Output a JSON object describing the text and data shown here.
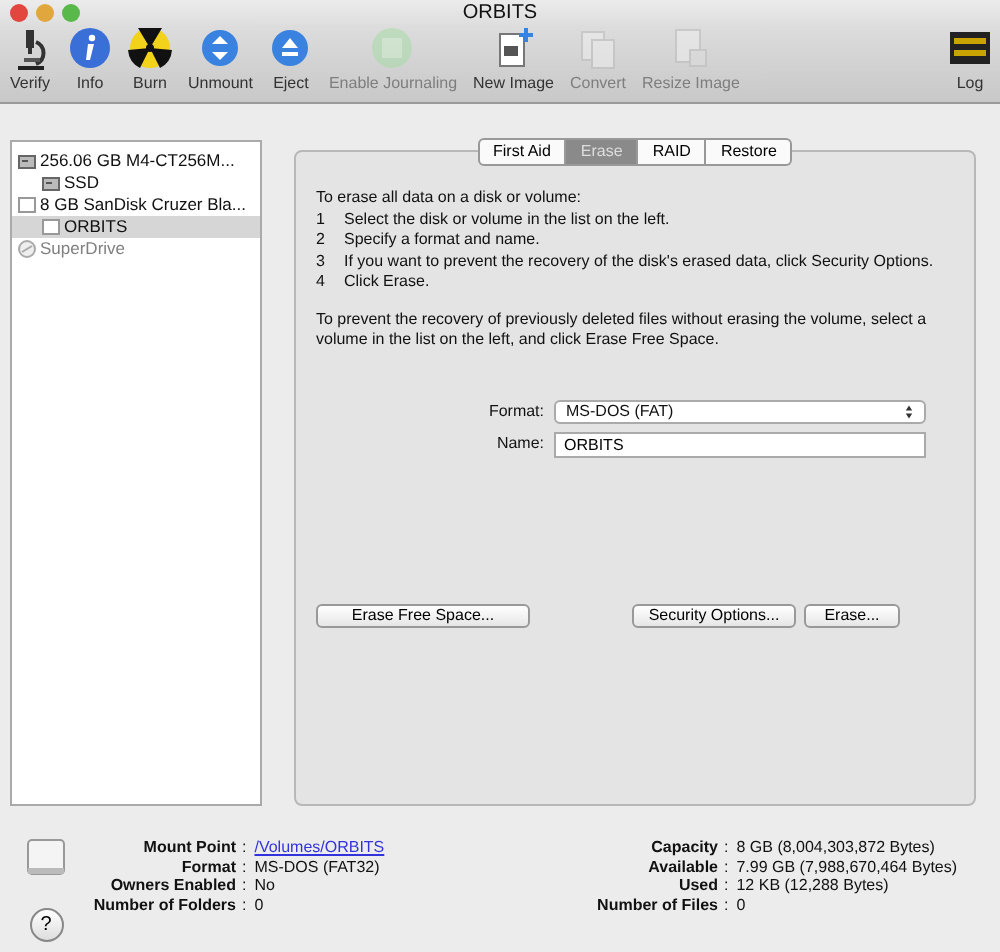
{
  "window": {
    "title": "ORBITS"
  },
  "toolbar": [
    {
      "label": "Verify",
      "kind": "microscope",
      "disabled": false
    },
    {
      "label": "Info",
      "kind": "info",
      "disabled": false
    },
    {
      "label": "Burn",
      "kind": "burn",
      "disabled": false
    },
    {
      "label": "Unmount",
      "kind": "unmount",
      "disabled": false
    },
    {
      "label": "Eject",
      "kind": "eject",
      "disabled": false
    },
    {
      "label": "Enable Journaling",
      "kind": "journal",
      "disabled": true
    },
    {
      "label": "New Image",
      "kind": "new-image",
      "disabled": false
    },
    {
      "label": "Convert",
      "kind": "convert",
      "disabled": true
    },
    {
      "label": "Resize Image",
      "kind": "resize",
      "disabled": true
    },
    {
      "label": "Log",
      "kind": "log",
      "disabled": false
    }
  ],
  "sidebar": {
    "items": [
      {
        "label": "256.06 GB M4-CT256M...",
        "kind": "hard-disk",
        "selected": false,
        "disabled": false,
        "children": [
          {
            "label": "SSD",
            "kind": "hard-disk",
            "selected": false,
            "disabled": false
          }
        ]
      },
      {
        "label": "8 GB SanDisk Cruzer Bla...",
        "kind": "usb-disk",
        "selected": false,
        "disabled": false,
        "children": [
          {
            "label": "ORBITS",
            "kind": "usb-disk",
            "selected": true,
            "disabled": false
          }
        ]
      },
      {
        "label": "SuperDrive",
        "kind": "optical",
        "selected": false,
        "disabled": true
      }
    ]
  },
  "tabs": [
    {
      "label": "First Aid",
      "selected": false
    },
    {
      "label": "Erase",
      "selected": true
    },
    {
      "label": "RAID",
      "selected": false
    },
    {
      "label": "Restore",
      "selected": false
    }
  ],
  "instructions": {
    "intro": "To erase all data on a disk or volume:",
    "steps": [
      {
        "number": "1",
        "text": "Select the disk or volume in the list on the left."
      },
      {
        "number": "2",
        "text": "Specify a format and name."
      },
      {
        "number": "3",
        "text": "If you want to prevent the recovery of the disk's erased data, click Security Options."
      },
      {
        "number": "4",
        "text": "Click Erase."
      }
    ],
    "note": "To prevent the recovery of previously deleted files without erasing the volume, select a volume in the list on the left, and click Erase Free Space."
  },
  "format": {
    "label": "Format:",
    "value": "MS-DOS (FAT)"
  },
  "name": {
    "label": "Name:",
    "value": "ORBITS"
  },
  "buttons": {
    "left": [
      "Erase Free Space..."
    ],
    "right": [
      "Security Options...",
      "Erase..."
    ]
  },
  "info": {
    "left": [
      {
        "label": "Mount Point",
        "value": "/Volumes/ORBITS",
        "kind": "link"
      },
      {
        "label": "Format",
        "value": "MS-DOS (FAT32)",
        "kind": "text"
      },
      {
        "label": "Owners Enabled",
        "value": "No",
        "kind": "text"
      },
      {
        "label": "Number of Folders",
        "value": "0",
        "kind": "text"
      }
    ],
    "right": [
      {
        "label": "Capacity",
        "value": "8 GB (8,004,303,872 Bytes)",
        "kind": "text"
      },
      {
        "label": "Available",
        "value": "7.99 GB (7,988,670,464 Bytes)",
        "kind": "text"
      },
      {
        "label": "Used",
        "value": "12 KB (12,288 Bytes)",
        "kind": "text"
      },
      {
        "label": "Number of Files",
        "value": "0",
        "kind": "text"
      }
    ],
    "separator": ":"
  },
  "help_button": "?"
}
